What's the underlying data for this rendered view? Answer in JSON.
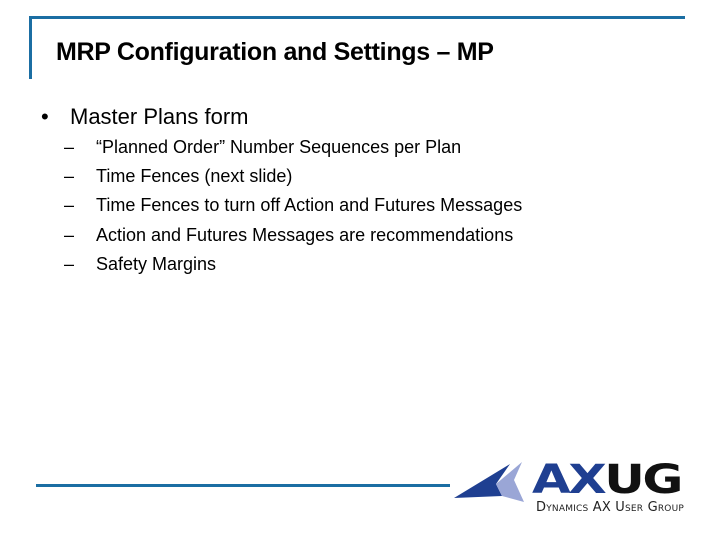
{
  "slide": {
    "title": "MRP Configuration and Settings – MP",
    "bullet": {
      "marker": "•",
      "text": "Master Plans form",
      "sub_marker": "–",
      "sub_items": [
        "“Planned Order” Number Sequences per Plan",
        "Time Fences (next slide)",
        "Time Fences to turn off Action and Futures Messages",
        "Action and Futures Messages are recommendations",
        "Safety Margins"
      ]
    }
  },
  "logo": {
    "mark_ax": "AX",
    "mark_ug": "UG",
    "tagline": "Dynamics AX User Group",
    "colors": {
      "primary_blue": "#1f3f91",
      "light_blue": "#9aa6d6",
      "dark": "#111111"
    }
  },
  "theme": {
    "accent": "#1b6ea3"
  }
}
